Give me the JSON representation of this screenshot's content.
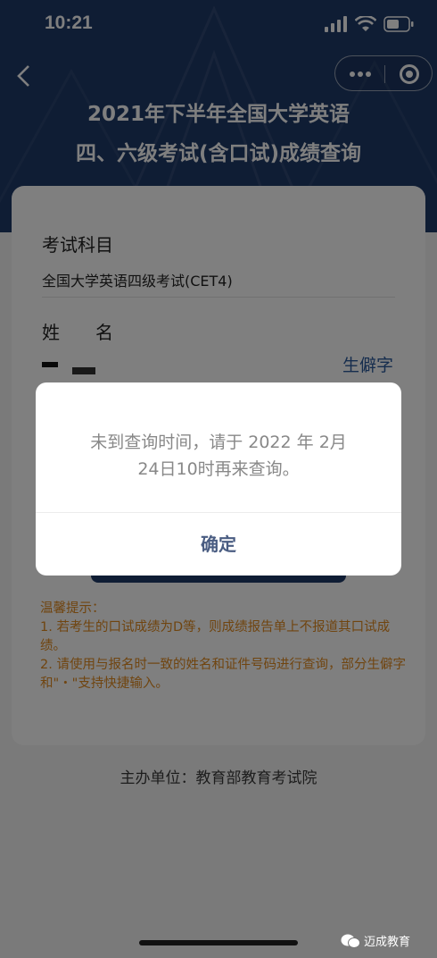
{
  "status_bar": {
    "time": "10:21"
  },
  "header": {
    "title_line1": "2021年下半年全国大学英语",
    "title_line2": "四、六级考试(含口试)成绩查询"
  },
  "form": {
    "subject_label": "考试科目",
    "subject_value": "全国大学英语四级考试(CET4)",
    "name_label": "姓　　名",
    "rare_char_link": "生僻字"
  },
  "tips": {
    "title": "温馨提示：",
    "line1": "1. 若考生的口试成绩为D等，则成绩报告单上不报道其口试成绩。",
    "line2": "2. 请使用与报名时一致的姓名和证件号码进行查询，部分生僻字和\"・\"支持快捷输入。"
  },
  "footer": {
    "organizer": "主办单位：教育部教育考试院"
  },
  "modal": {
    "message_line1": "未到查询时间，请于 2022 年 2月",
    "message_line2": "24日10时再来查询。",
    "confirm_label": "确定"
  },
  "watermark": {
    "text": "迈成教育"
  },
  "colors": {
    "header": "#1f3a69",
    "accent_link": "#2c5b9c",
    "tips": "#e08a21",
    "modal_button": "#4a5d82"
  }
}
